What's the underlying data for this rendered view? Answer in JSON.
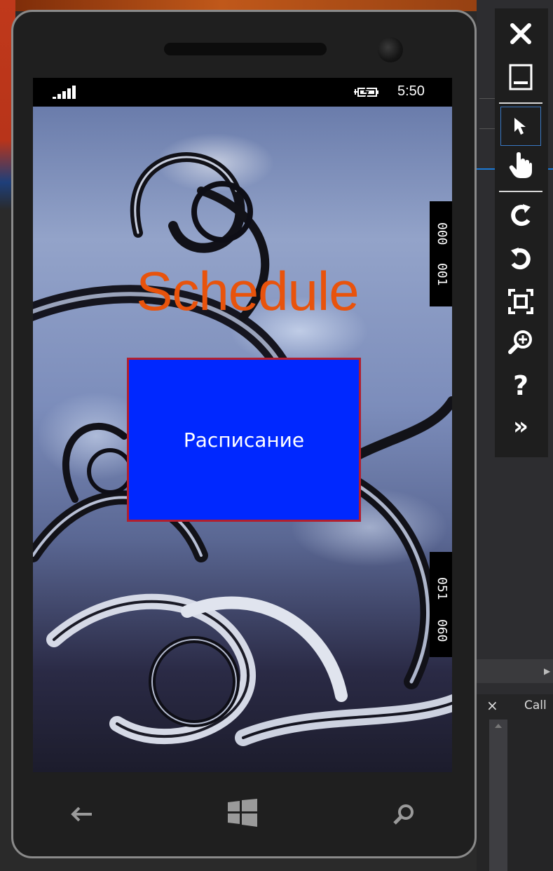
{
  "phone": {
    "status_bar": {
      "time": "5:50",
      "signal_icon": "signal-bars-icon",
      "battery_icon": "charging-battery-icon"
    },
    "app": {
      "title": "Schedule",
      "button_label": "Расписание",
      "title_color": "#e8530c",
      "button_color": "#0028ff",
      "button_border_color": "#b21e2e"
    },
    "frame_counters": {
      "top": [
        "000",
        "001"
      ],
      "bottom": [
        "051",
        "060"
      ]
    },
    "nav_bar": {
      "back_icon": "back-arrow-icon",
      "start_icon": "windows-start-icon",
      "search_icon": "search-icon"
    }
  },
  "tools": [
    {
      "name": "close-icon"
    },
    {
      "name": "minimize-icon"
    },
    {
      "name": "cursor-pointer-icon",
      "selected": true
    },
    {
      "name": "hand-touch-icon"
    },
    {
      "name": "rotate-left-icon"
    },
    {
      "name": "rotate-right-icon"
    },
    {
      "name": "fit-to-screen-icon"
    },
    {
      "name": "zoom-icon"
    },
    {
      "name": "help-icon",
      "symbol": "?"
    },
    {
      "name": "more-tools-icon",
      "symbol": "»"
    }
  ],
  "ide_panel": {
    "close_symbol": "×",
    "tab_label": "Call"
  }
}
